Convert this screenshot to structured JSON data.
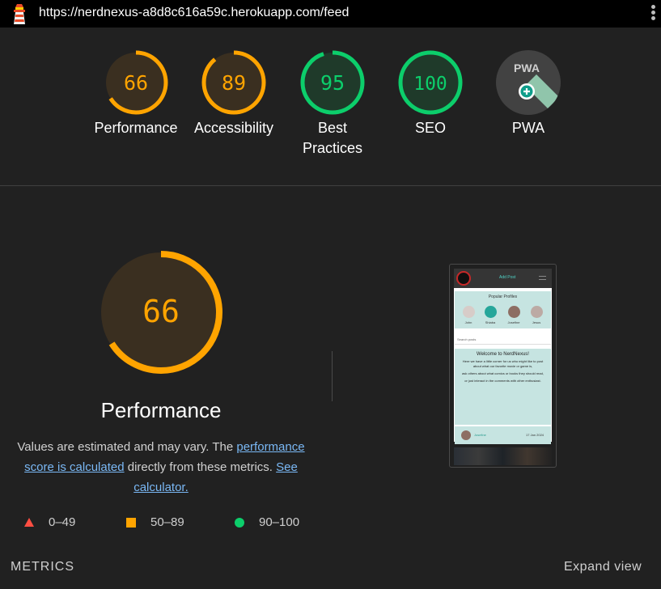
{
  "header": {
    "url": "https://nerdnexus-a8d8c616a59c.herokuapp.com/feed",
    "logo_icon": "lighthouse-icon",
    "menu_icon": "more-vert-icon"
  },
  "colors": {
    "average": "#ffa400",
    "pass": "#0cce6b",
    "fail": "#ff4e42",
    "link": "#7ab8f5"
  },
  "gauges": [
    {
      "score": "66",
      "label": "Performance",
      "status": "average"
    },
    {
      "score": "89",
      "label": "Accessibility",
      "status": "average"
    },
    {
      "score": "95",
      "label_line1": "Best",
      "label_line2": "Practices",
      "status": "pass"
    },
    {
      "score": "100",
      "label": "SEO",
      "status": "pass"
    },
    {
      "label": "PWA",
      "badge_text": "PWA",
      "icon": "pwa-badge-icon"
    }
  ],
  "performance": {
    "score": "66",
    "score_fraction": 0.66,
    "title": "Performance",
    "desc_prefix": "Values are estimated and may vary. The ",
    "link1": "performance score is calculated",
    "desc_middle": " directly from these metrics. ",
    "link2": "See calculator."
  },
  "legend": [
    {
      "range": "0–49",
      "shape": "triangle",
      "status": "fail"
    },
    {
      "range": "50–89",
      "shape": "square",
      "status": "average"
    },
    {
      "range": "90–100",
      "shape": "circle",
      "status": "pass"
    }
  ],
  "metrics": {
    "title": "METRICS",
    "expand_label": "Expand view"
  },
  "screenshot": {
    "nav_label": "Add Post",
    "profiles_title": "Popular Profiles",
    "profiles": [
      "John",
      "Shiaba",
      "Josefine",
      "Jesus"
    ],
    "search_placeholder": "Search posts",
    "welcome_title": "Welcome to NerdNexus!",
    "welcome_p1": "Here we have a little corner for us who might like to post about what our favorite movie or game is,",
    "welcome_p2": "ask others about what comics or books they should read,",
    "welcome_p3": "or just interact in the comments with other enthusiast.",
    "post_author": "Josefine",
    "post_date": "17 Jan 2024"
  }
}
